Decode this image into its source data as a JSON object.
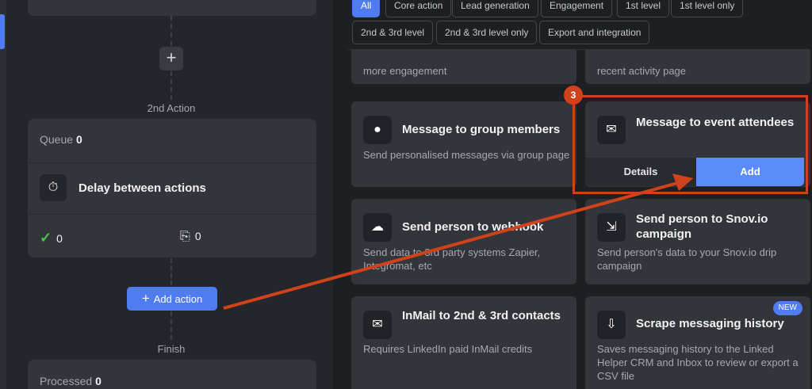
{
  "workflow": {
    "second_action_label": "2nd Action",
    "queue_label": "Queue",
    "queue_count": "0",
    "delay_label": "Delay between actions",
    "success_count": "0",
    "skipped_count": "0",
    "add_action_label": "Add action",
    "finish_label": "Finish",
    "processed_label": "Processed",
    "processed_count": "0"
  },
  "filters": [
    {
      "label": "All",
      "active": true
    },
    {
      "label": "Core action"
    },
    {
      "label": "Lead generation"
    },
    {
      "label": "Engagement"
    },
    {
      "label": "1st level"
    },
    {
      "label": "1st level only"
    },
    {
      "label": "2nd & 3rd level"
    },
    {
      "label": "2nd & 3rd level only"
    },
    {
      "label": "Export and integration"
    }
  ],
  "cards": {
    "partial_left": {
      "description": "more engagement"
    },
    "partial_right": {
      "description": "recent activity page"
    },
    "group": {
      "title": "Message to group members",
      "description": "Send personalised messages via group page",
      "icon": "chat-bubble-icon"
    },
    "event": {
      "title": "Message to event attendees",
      "details_label": "Details",
      "add_label": "Add",
      "icon": "event-message-icon"
    },
    "webhook": {
      "title": "Send person to webhook",
      "description": "Send data to 3rd party systems Zapier, Integromat, etc",
      "icon": "cloud-upload-icon"
    },
    "snov": {
      "title": "Send person to Snov.io campaign",
      "description": "Send person's data to your Snov.io drip campaign",
      "icon": "person-send-icon"
    },
    "inmail": {
      "title": "InMail to 2nd & 3rd contacts",
      "description": "Requires LinkedIn paid InMail credits",
      "icon": "mail-icon"
    },
    "scrape": {
      "title": "Scrape messaging history",
      "description": "Saves messaging history to the Linked Helper CRM and Inbox to review or export a CSV file",
      "badge": "NEW",
      "icon": "scrape-history-icon"
    }
  },
  "tutorial": {
    "step_number": "3"
  },
  "colors": {
    "accent": "#4f7df0",
    "highlight": "#d0431a",
    "success": "#4cc44c"
  }
}
